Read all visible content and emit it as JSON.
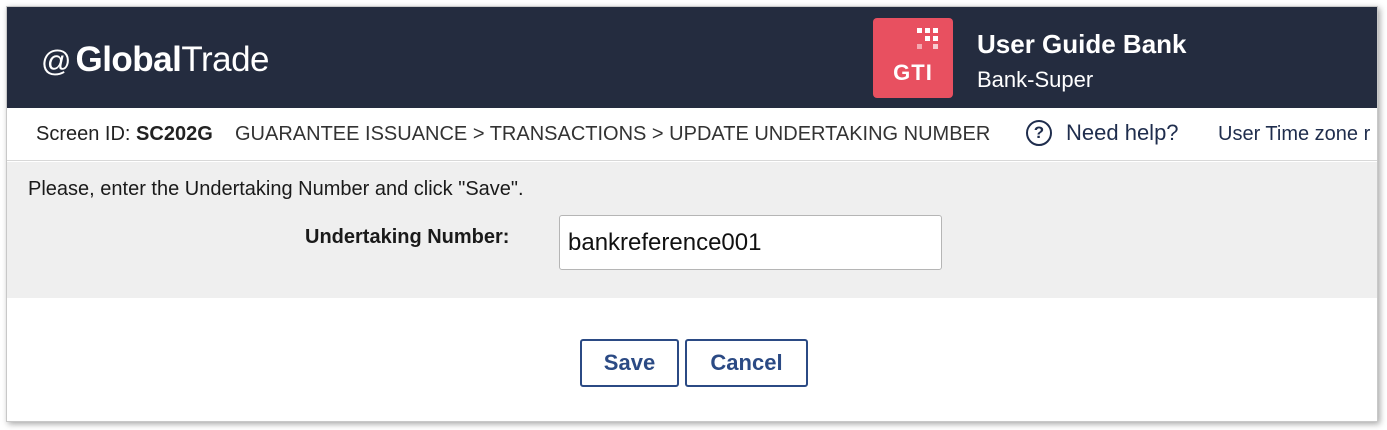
{
  "header": {
    "logo_at": "@",
    "logo_global": "Global",
    "logo_trade": "Trade",
    "badge_text": "GTI",
    "bank_name": "User Guide Bank",
    "user_role": "Bank-Super",
    "colors": {
      "header_bg": "#242c3f",
      "badge_bg": "#e85060"
    }
  },
  "breadcrumb": {
    "screen_id_label": "Screen ID:",
    "screen_id": "SC202G",
    "path": "GUARANTEE ISSUANCE > TRANSACTIONS > UPDATE UNDERTAKING NUMBER",
    "help_icon": "question-circle-icon",
    "help_label": "Need help?",
    "timezone_label": "User Time zone r"
  },
  "form": {
    "instruction": "Please, enter the Undertaking Number and click \"Save\".",
    "undertaking_label": "Undertaking Number:",
    "undertaking_value": "bankreference001"
  },
  "actions": {
    "save_label": "Save",
    "cancel_label": "Cancel",
    "button_color": "#2b4a84"
  }
}
